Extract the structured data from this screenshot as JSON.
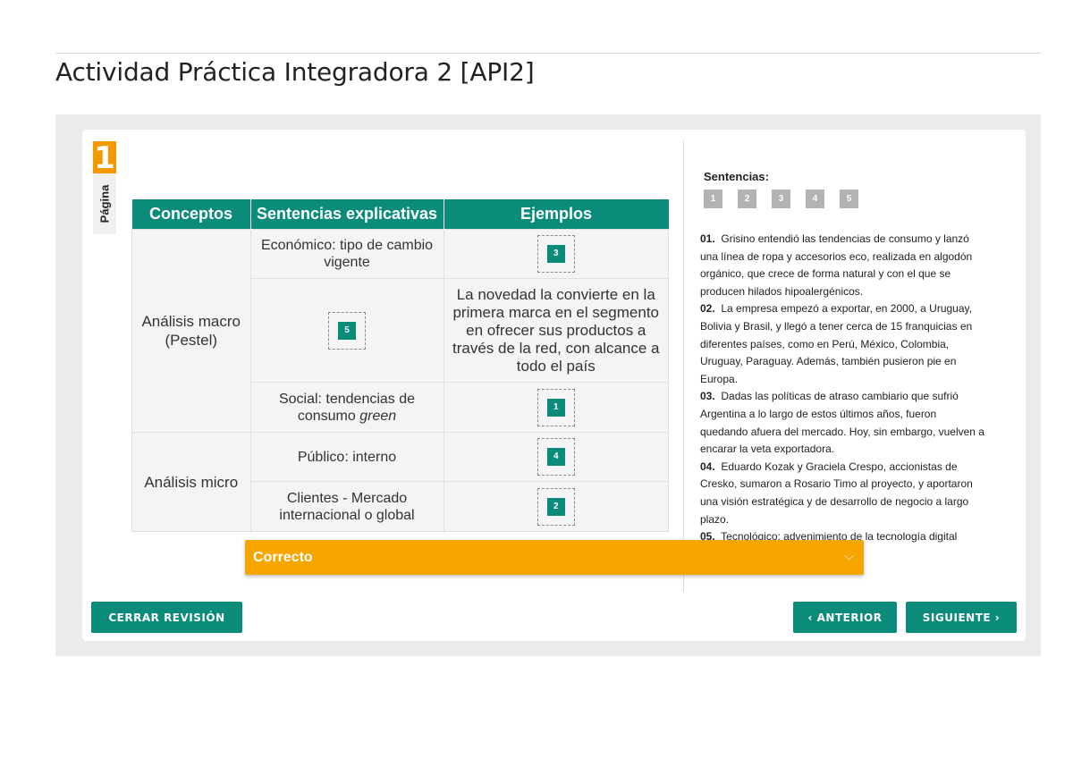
{
  "page": {
    "title": "Actividad Práctica Integradora 2 [API2]"
  },
  "page_badge": {
    "number": "1",
    "label": "Página"
  },
  "table": {
    "headers": [
      "Conceptos",
      "Sentencias explicativas",
      "Ejemplos"
    ],
    "groups": [
      "Análisis macro (Pestel)",
      "Análisis micro"
    ],
    "rows": [
      {
        "sentencia": "Económico: tipo de cambio vigente",
        "ejemplo_chip": "3"
      },
      {
        "sentencia_chip": "5",
        "ejemplo": "La novedad la convierte en la primera marca en el segmento en ofrecer sus productos a través de la red, con alcance a todo el país"
      },
      {
        "sentencia_pre": "Social: tendencias de consumo ",
        "sentencia_em": "green",
        "ejemplo_chip": "1"
      },
      {
        "sentencia": "Público: interno",
        "ejemplo_chip": "4"
      },
      {
        "sentencia": "Clientes - Mercado internacional o global",
        "ejemplo_chip": "2"
      }
    ]
  },
  "sentences": {
    "title": "Sentencias:",
    "chips": [
      "1",
      "2",
      "3",
      "4",
      "5"
    ],
    "items": [
      {
        "num": "01.",
        "text": "Grisino entendió las tendencias de consumo y lanzó una línea de ropa y accesorios eco, realizada en algodón orgánico, que crece de forma natural y con el que se producen hilados hipoalergénicos."
      },
      {
        "num": "02.",
        "text": "La empresa empezó a exportar, en 2000, a Uruguay, Bolivia y Brasil, y llegó a tener cerca de 15 franquicias en diferentes países, como en Perú, México, Colombia, Uruguay, Paraguay. Además, también pusieron pie en Europa."
      },
      {
        "num": "03.",
        "text": "Dadas las políticas de atraso cambiario que sufrió Argentina a lo largo de estos últimos años, fueron quedando afuera del mercado. Hoy, sin embargo, vuelven a encarar la veta exportadora."
      },
      {
        "num": "04.",
        "text": "Eduardo Kozak y Graciela Crespo, accionistas de Cresko, sumaron a Rosario Timo al proyecto, y aportaron una visión estratégica y de desarrollo de negocio a largo plazo."
      },
      {
        "num": "05.",
        "text": "Tecnológico: advenimiento de la tecnología digital"
      }
    ]
  },
  "feedback": {
    "label": "Correcto"
  },
  "buttons": {
    "close": "CERRAR REVISIÓN",
    "prev": "‹ ANTERIOR",
    "next": "SIGUIENTE ›"
  },
  "colors": {
    "accent": "#0b8c7b",
    "orange": "#f49a00",
    "feedback": "#f7a600"
  }
}
